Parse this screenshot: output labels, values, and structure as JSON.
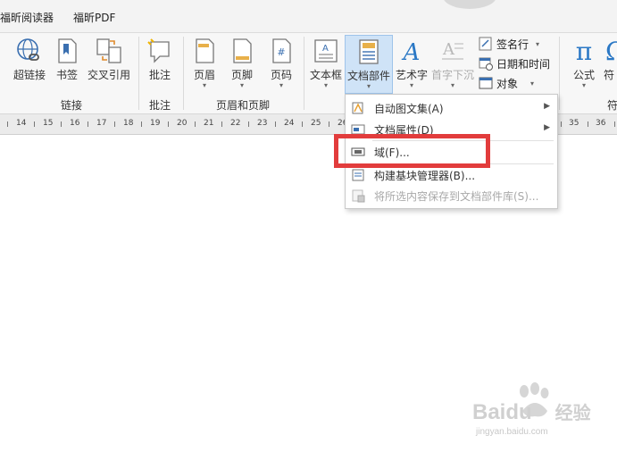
{
  "tabs": [
    {
      "label": "福昕阅读器"
    },
    {
      "label": "福昕PDF"
    }
  ],
  "ribbon": {
    "buttons": {
      "hyperlink": "超链接",
      "bookmark": "书签",
      "cross_reference": "交叉引用",
      "comment": "批注",
      "header": "页眉",
      "footer": "页脚",
      "page_number": "页码",
      "text_box": "文本框",
      "quick_parts": "文档部件",
      "wordart": "艺术字",
      "drop_cap": "首字下沉",
      "equation": "公式",
      "symbol_partial": "符"
    },
    "small_buttons": {
      "signature_line": "签名行",
      "date_time": "日期和时间",
      "object": "对象"
    },
    "groups": {
      "links": "链接",
      "comments": "批注",
      "header_footer": "页眉和页脚",
      "symbols_partial": "符"
    }
  },
  "ruler": {
    "numbers": [
      "14",
      "15",
      "16",
      "17",
      "18",
      "19",
      "20",
      "21",
      "22",
      "23",
      "24",
      "25",
      "26",
      "35",
      "36"
    ]
  },
  "menu": {
    "items": [
      {
        "label": "自动图文集(A)",
        "has_submenu": true,
        "enabled": true
      },
      {
        "label": "文档属性(D)",
        "has_submenu": true,
        "enabled": true
      },
      {
        "label": "域(F)...",
        "has_submenu": false,
        "enabled": true
      },
      {
        "label": "构建基块管理器(B)...",
        "has_submenu": false,
        "enabled": true
      },
      {
        "label": "将所选内容保存到文档部件库(S)...",
        "has_submenu": false,
        "enabled": false
      }
    ]
  },
  "watermark": {
    "brand": "Baidu",
    "brand_cn": "经验",
    "url": "jingyan.baidu.com"
  },
  "colors": {
    "accent": "#2b78c5",
    "highlight_box": "#e23c3c",
    "active_button": "#cfe3f7"
  }
}
